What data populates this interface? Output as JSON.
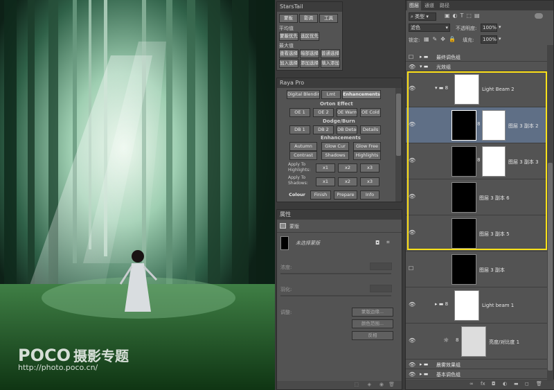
{
  "watermark": {
    "logo": "POCO",
    "logo_suffix": "摄影专题",
    "url": "http://photo.poco.cn/"
  },
  "starstail": {
    "title": "StarsTail",
    "tabs": [
      "蒙板",
      "影调",
      "工具"
    ],
    "section1": "平均值",
    "section1_buttons": [
      "蒙蔽优先",
      "选区优先"
    ],
    "section2": "最大值",
    "row1": [
      "查看选择",
      "暗部选择",
      "普通选择"
    ],
    "row2": [
      "加入选择",
      "添加选择",
      "填入添加"
    ]
  },
  "raya": {
    "title": "Raya Pro",
    "tabs": [
      "Digital Blending",
      "Lmt",
      "Enhancements"
    ],
    "orton_title": "Orton Effect",
    "orton": [
      "OE 1",
      "OE 2",
      "OE Warm",
      "OE Cold"
    ],
    "dodge_title": "Dodge/Burn",
    "dodge": [
      "DB 1",
      "DB 2",
      "DB Details",
      "Details"
    ],
    "enh_title": "Enhancements",
    "enh_row1": [
      "Autumn",
      "Glow Cur",
      "Glow Free"
    ],
    "enh_row2": [
      "Contrast",
      "Shadows",
      "Highlights"
    ],
    "apply_highlights": "Apply To Highlights:",
    "apply_shadows": "Apply To Shadows:",
    "multipliers": [
      "x1",
      "x2",
      "x3"
    ],
    "bottom": [
      "Colour",
      "Finish",
      "Prepare",
      "Info"
    ]
  },
  "properties": {
    "title": "属性",
    "mask_label": "蒙版",
    "mask_name": "未选择蒙版",
    "density": "浓度:",
    "feather": "羽化:",
    "adjust": "调整:",
    "buttons": [
      "蒙版边缘...",
      "颜色范围...",
      "反相"
    ]
  },
  "layers": {
    "tabs": [
      "图层",
      "通道",
      "路径"
    ],
    "filter": "类型",
    "blend_mode": "滤色",
    "opacity_label": "不透明度:",
    "opacity": "100%",
    "lock_label": "锁定:",
    "fill_label": "填充:",
    "fill": "100%",
    "groups": {
      "final": "最终调色组",
      "light": "光效组",
      "fog": "晨雾效果组",
      "base": "基本调色组"
    },
    "items": [
      {
        "name": "Light Beam 2"
      },
      {
        "name": "图层 3 副本 2"
      },
      {
        "name": "图层 3 副本 3"
      },
      {
        "name": "图层 3 副本 6"
      },
      {
        "name": "图层 3 副本 5"
      },
      {
        "name": "图层 3 副本"
      },
      {
        "name": "Light beam 1"
      },
      {
        "name": "亮度/对比度 1"
      }
    ],
    "footer": [
      "fx"
    ]
  }
}
